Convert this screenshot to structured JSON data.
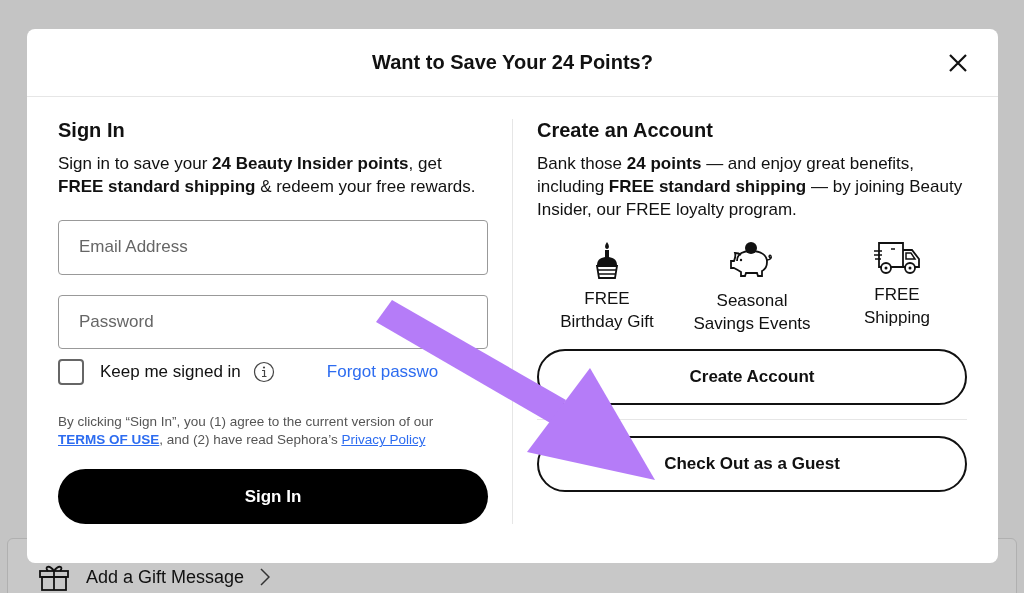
{
  "modal": {
    "title": "Want to Save Your 24 Points?"
  },
  "sign_in": {
    "heading": "Sign In",
    "intro": "Sign in to save your **24 Beauty Insider points**, get **FREE standard shipping** & redeem your free rewards.",
    "fields": [
      {
        "placeholder": "Email Address"
      },
      {
        "placeholder": "Password"
      }
    ],
    "keep_signed_in": {
      "label": "Keep me signed in",
      "checked": false
    },
    "forgot_link": "Forgot passwo",
    "legal": {
      "before": "By clicking “Sign In”, you (1) agree to the current version of our",
      "terms_link": "TERMS OF USE",
      "middle": ", and (2) have read Sephora’s",
      "privacy_link": "Privacy Policy"
    },
    "button": "Sign In"
  },
  "create_account": {
    "heading": "Create an Account",
    "intro": "Bank those **24 points** — and enjoy great benefits, including **FREE standard shipping** — by joining Beauty Insider, our FREE loyalty program.",
    "benefits": [
      {
        "kind": "cake",
        "line1": "FREE",
        "line2": "Birthday Gift"
      },
      {
        "kind": "piggy",
        "line1": "Seasonal",
        "line2": "Savings Events"
      },
      {
        "kind": "truck",
        "line1": "FREE",
        "line2": "Shipping"
      }
    ],
    "buttons": [
      "Create Account",
      "Check Out as a Guest"
    ]
  },
  "background": {
    "gift_row": "Add a Gift Message"
  }
}
